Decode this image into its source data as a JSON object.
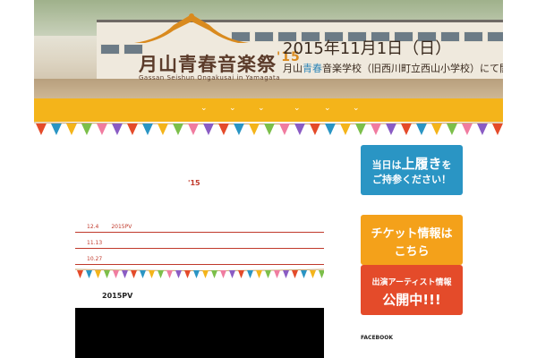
{
  "header": {
    "logo_kanji": "月山青春音楽祭",
    "logo_num": "'15",
    "logo_sub": "Gassan Seishun Ongakusai in Yamagata",
    "date": "2015年11月1日（日）",
    "venue_pre": "月山",
    "venue_hl": "青春",
    "venue_post": "音楽学校（旧西川町立西山小学校）にて開催"
  },
  "nav": {
    "items": [
      "⌄",
      "⌄",
      "⌄",
      "⌄",
      "⌄",
      "⌄"
    ]
  },
  "main": {
    "page_title": "'15",
    "posts": [
      {
        "date": "12.4",
        "title": "2015PV"
      },
      {
        "date": "11.13",
        "title": ""
      },
      {
        "date": "10.27",
        "title": ""
      }
    ],
    "pv_title": "2015PV"
  },
  "sidebar": {
    "banner1": {
      "line1_pre": "当日は",
      "line1_big": "上履き",
      "line1_post": "を",
      "line2": "ご持参ください！"
    },
    "banner2": {
      "line1": "チケット情報は",
      "line2": "こちら"
    },
    "banner3": {
      "line1": "出演アーティスト情報",
      "line2": "公開中!!!"
    },
    "facebook": "FACEBOOK"
  },
  "colors": {
    "accent_orange": "#f4b41a",
    "accent_red": "#c0392b",
    "banner_blue": "#2a95c4",
    "banner_orange": "#f4a11a",
    "banner_red": "#e44b2a"
  }
}
